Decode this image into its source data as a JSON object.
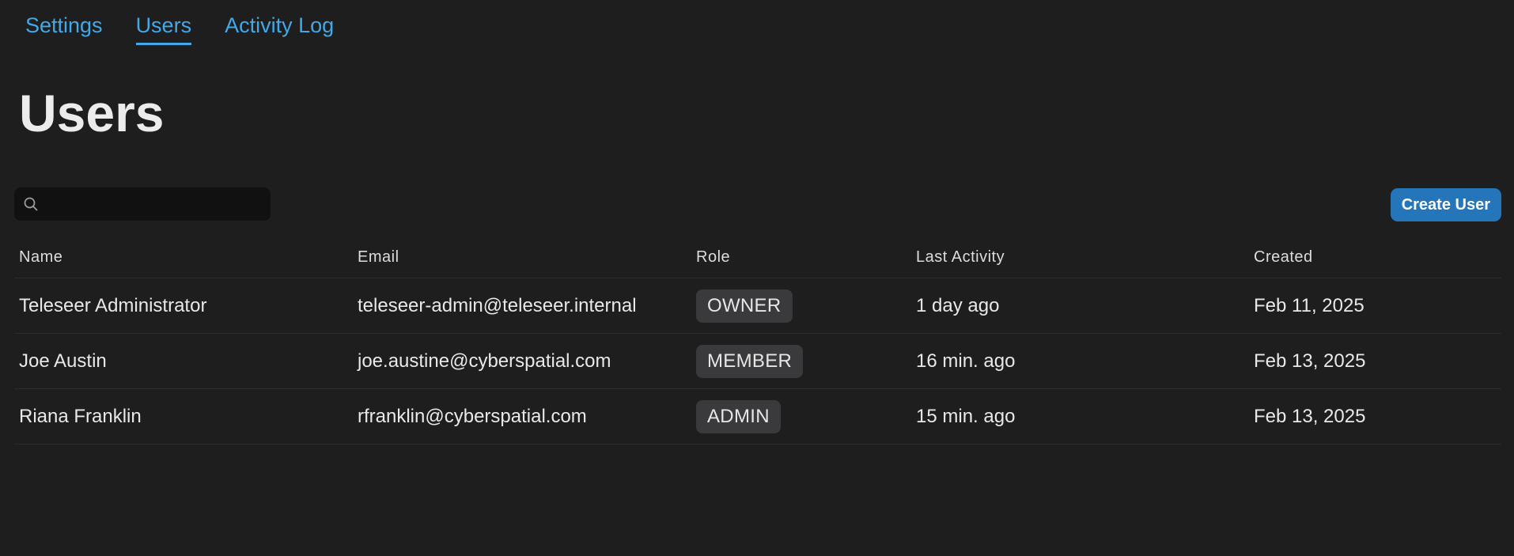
{
  "tabs": [
    {
      "label": "Settings",
      "active": false
    },
    {
      "label": "Users",
      "active": true
    },
    {
      "label": "Activity Log",
      "active": false
    }
  ],
  "page_title": "Users",
  "search": {
    "placeholder": "",
    "value": "",
    "icon": "search-icon"
  },
  "toolbar": {
    "create_label": "Create User"
  },
  "table": {
    "headers": {
      "name": "Name",
      "email": "Email",
      "role": "Role",
      "last_activity": "Last Activity",
      "created": "Created"
    },
    "rows": [
      {
        "name": "Teleseer Administrator",
        "email": "teleseer-admin@teleseer.internal",
        "role": "OWNER",
        "last_activity": "1 day ago",
        "created": "Feb 11, 2025"
      },
      {
        "name": "Joe Austin",
        "email": "joe.austine@cyberspatial.com",
        "role": "MEMBER",
        "last_activity": "16 min. ago",
        "created": "Feb 13, 2025"
      },
      {
        "name": "Riana Franklin",
        "email": "rfranklin@cyberspatial.com",
        "role": "ADMIN",
        "last_activity": "15 min. ago",
        "created": "Feb 13, 2025"
      }
    ]
  },
  "colors": {
    "background": "#1e1e1e",
    "accent": "#3fa9ea",
    "button": "#2475ba",
    "badge": "#3a3a3c"
  }
}
